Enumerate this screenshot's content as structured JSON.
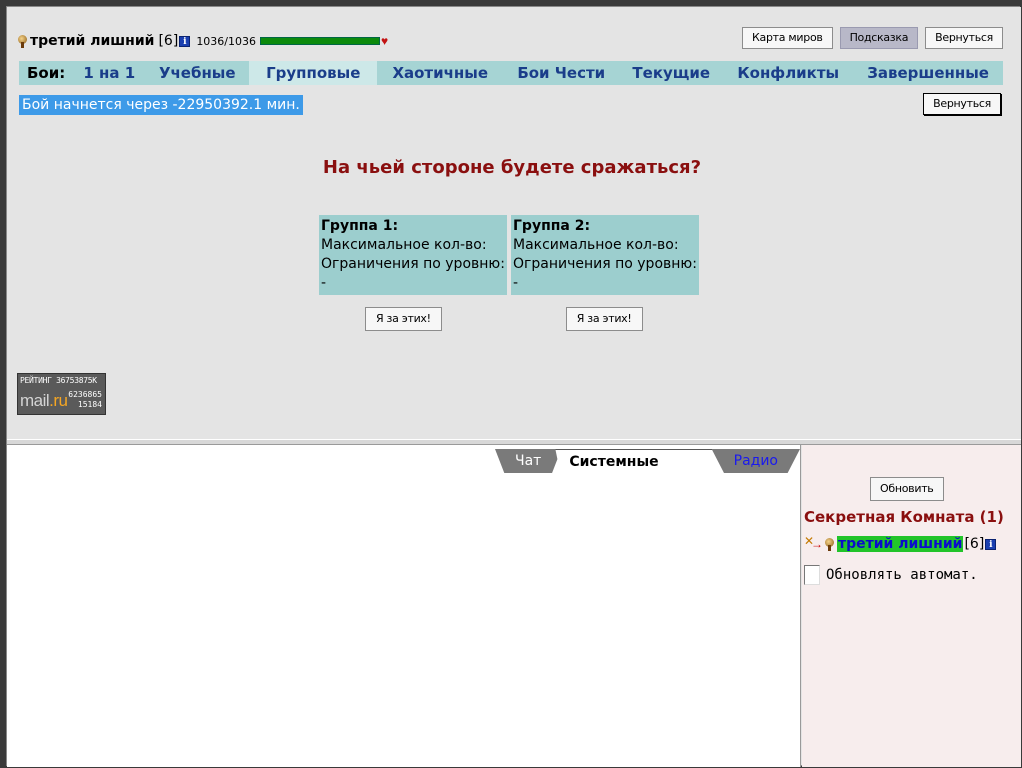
{
  "character": {
    "name": "третий лишний",
    "level": "[6]",
    "info_glyph": "i",
    "hp": "1036/1036",
    "hp_fraction": 1.0
  },
  "top_buttons": {
    "world_map": "Карта миров",
    "hint": "Подсказка",
    "back": "Вернуться"
  },
  "tabs": {
    "label": "Бои:",
    "items": [
      "1 на 1",
      "Учебные",
      "Групповые",
      "Хаотичные",
      "Бои Чести",
      "Текущие",
      "Конфликты",
      "Завершенные"
    ],
    "active": "Групповые"
  },
  "timer": "Бой начнется через -22950392.1 мин.",
  "back_button": "Вернуться",
  "question": "На чьей стороне будете сражаться?",
  "groups": [
    {
      "title": "Группа 1:",
      "max_label": "Максимальное кол-во:",
      "level_label": "Ограничения по уровню: -",
      "join": "Я за этих!"
    },
    {
      "title": "Группа 2:",
      "max_label": "Максимальное кол-во:",
      "level_label": "Ограничения по уровню: -",
      "join": "Я за этих!"
    }
  ],
  "counter": {
    "rating": "РЕЙТИНГ 36753875K",
    "logo_mail": "mail",
    "logo_ru": ".ru",
    "n1": "6236865",
    "n2": "15184"
  },
  "chat_tabs": [
    "Чат",
    "Системные сообщения",
    "Радио"
  ],
  "side": {
    "refresh": "Обновить",
    "room": "Секретная Комната (1)",
    "user_name": "третий лишний",
    "user_level": "[6]",
    "auto_refresh_label": "Обновлять автомат."
  },
  "colors": {
    "tab_bar": "#a6d4d4",
    "group_bg": "#9ccece",
    "question": "#8a0f0f",
    "timer_bg": "#3d9ae8",
    "hp_bar": "#0c8a0c"
  }
}
